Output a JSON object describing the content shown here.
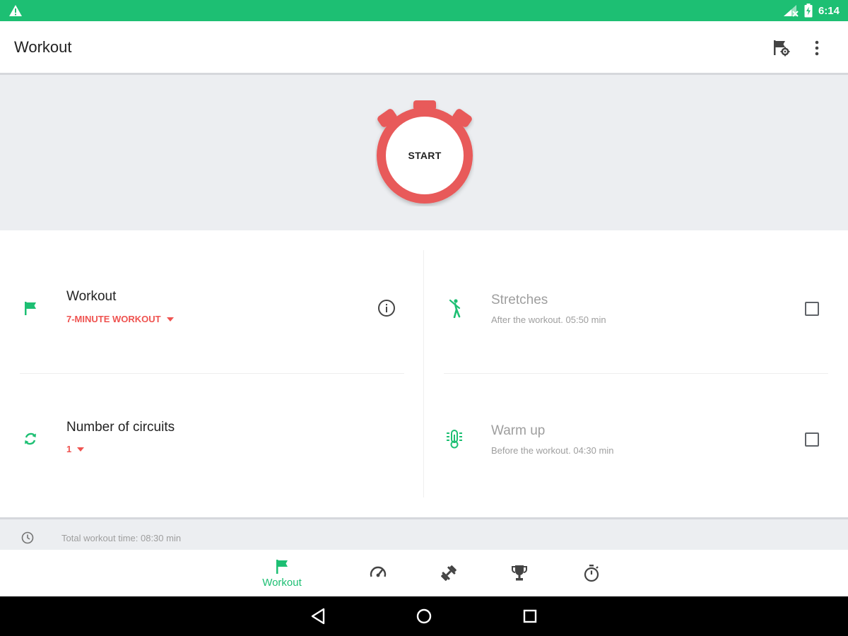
{
  "status_bar": {
    "time": "6:14"
  },
  "app_bar": {
    "title": "Workout"
  },
  "hero": {
    "start_label": "START"
  },
  "workout_row": {
    "title": "Workout",
    "value": "7-MINUTE WORKOUT"
  },
  "circuits_row": {
    "title": "Number of circuits",
    "value": "1"
  },
  "stretches_row": {
    "title": "Stretches",
    "subtitle": "After the workout. 05:50 min",
    "checked": false
  },
  "warmup_row": {
    "title": "Warm up",
    "subtitle": "Before the workout. 04:30 min",
    "checked": false
  },
  "total": {
    "text": "Total workout time: 08:30 min"
  },
  "bottom_nav": {
    "items": [
      {
        "icon": "flag-icon",
        "label": "Workout",
        "active": true
      },
      {
        "icon": "speedometer-icon",
        "label": ""
      },
      {
        "icon": "dumbbell-icon",
        "label": ""
      },
      {
        "icon": "trophy-icon",
        "label": ""
      },
      {
        "icon": "stopwatch-icon",
        "label": ""
      }
    ]
  },
  "colors": {
    "accent": "#1dbf73",
    "red": "#ef5350",
    "stopwatch": "#e85a5a",
    "hero_bg": "#eceef1"
  }
}
